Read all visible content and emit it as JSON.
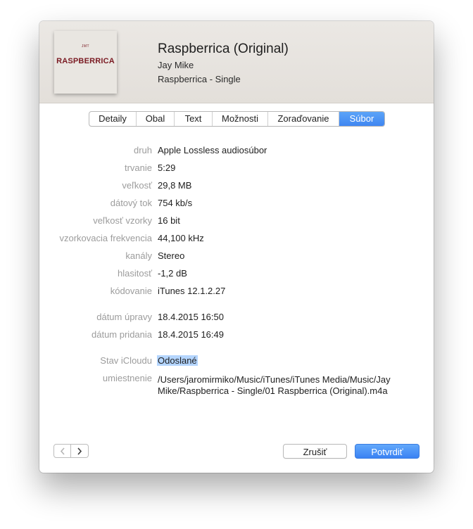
{
  "artwork": {
    "small_text": "JMT",
    "title_text": "RASPBERRICA"
  },
  "header": {
    "title": "Raspberrica (Original)",
    "artist": "Jay Mike",
    "album": "Raspberrica - Single"
  },
  "tabs": [
    {
      "label": "Detaily",
      "active": false
    },
    {
      "label": "Obal",
      "active": false
    },
    {
      "label": "Text",
      "active": false
    },
    {
      "label": "Možnosti",
      "active": false
    },
    {
      "label": "Zoraďovanie",
      "active": false
    },
    {
      "label": "Súbor",
      "active": true
    }
  ],
  "fields": [
    {
      "label": "druh",
      "value": "Apple Lossless audiosúbor"
    },
    {
      "label": "trvanie",
      "value": "5:29"
    },
    {
      "label": "veľkosť",
      "value": "29,8 MB"
    },
    {
      "label": "dátový tok",
      "value": "754 kb/s"
    },
    {
      "label": "veľkosť vzorky",
      "value": "16 bit"
    },
    {
      "label": "vzorkovacia frekvencia",
      "value": "44,100 kHz"
    },
    {
      "label": "kanály",
      "value": "Stereo"
    },
    {
      "label": "hlasitosť",
      "value": "-1,2 dB"
    },
    {
      "label": "kódovanie",
      "value": "iTunes 12.1.2.27"
    }
  ],
  "dates": [
    {
      "label": "dátum úpravy",
      "value": "18.4.2015 16:50"
    },
    {
      "label": "dátum pridania",
      "value": "18.4.2015 16:49"
    }
  ],
  "icloud": {
    "label": "Stav iCloudu",
    "value": "Odoslané"
  },
  "location": {
    "label": "umiestnenie",
    "line1": "/Users/jaromirmiko/Music/iTunes/iTunes Media/Music/Jay",
    "line2": "Mike/Raspberrica - Single/01 Raspberrica (Original).m4a"
  },
  "nav": {
    "prev_icon": "chevron-left-icon",
    "next_icon": "chevron-right-icon"
  },
  "buttons": {
    "cancel": "Zrušiť",
    "ok": "Potvrdiť"
  },
  "colors": {
    "accent": "#3f86f1",
    "selection": "#b4d5fe"
  }
}
